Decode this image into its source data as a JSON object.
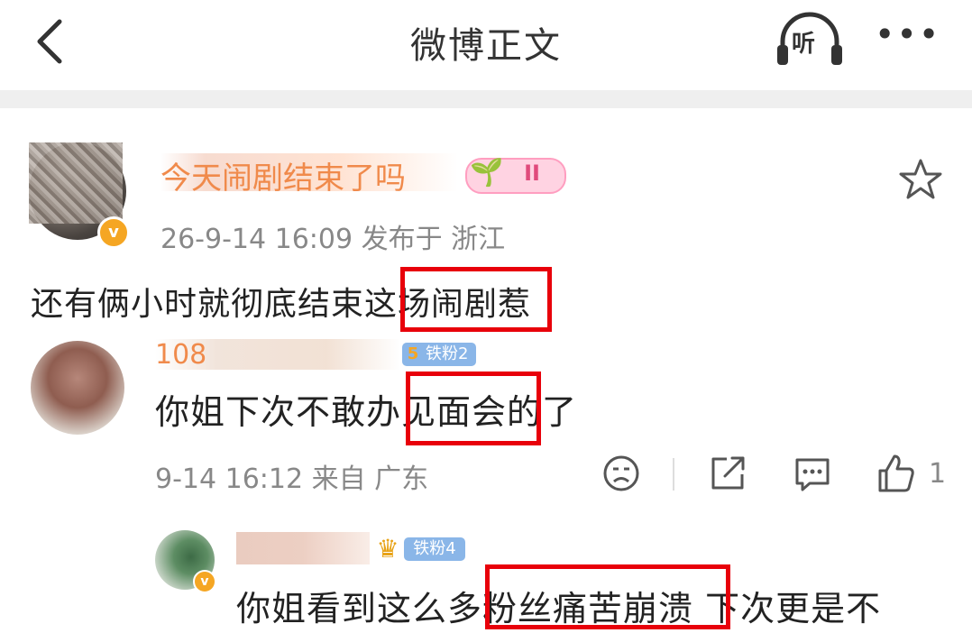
{
  "nav": {
    "title": "微博正文",
    "listen_label": "听",
    "more_label": "•••"
  },
  "post": {
    "username": "今天闹剧结束了吗",
    "level_badge": "II",
    "meta": "26-9-14 16:09  发布于 浙江",
    "body": "还有俩小时就彻底结束这场闹剧惹"
  },
  "comment1": {
    "username": "108",
    "fan_badge": "铁粉2",
    "fan_level": "5",
    "body": "你姐下次不敢办见面会的了",
    "meta": "9-14 16:12  来自 广东",
    "like_count": "1"
  },
  "reply1": {
    "fan_badge": "铁粉4",
    "body": "你姐看到这么多粉丝痛苦崩溃 下次更是不"
  },
  "colors": {
    "highlight_box": "#e8000a",
    "username": "#f08a4b",
    "fan_badge": "#8ab6e8",
    "vip_badge": "#f5a623"
  },
  "icons": [
    "back-icon",
    "headphones-icon",
    "more-icon",
    "star-icon",
    "sad-face-icon",
    "share-icon",
    "comment-icon",
    "like-icon",
    "crown-icon",
    "verified-icon"
  ]
}
